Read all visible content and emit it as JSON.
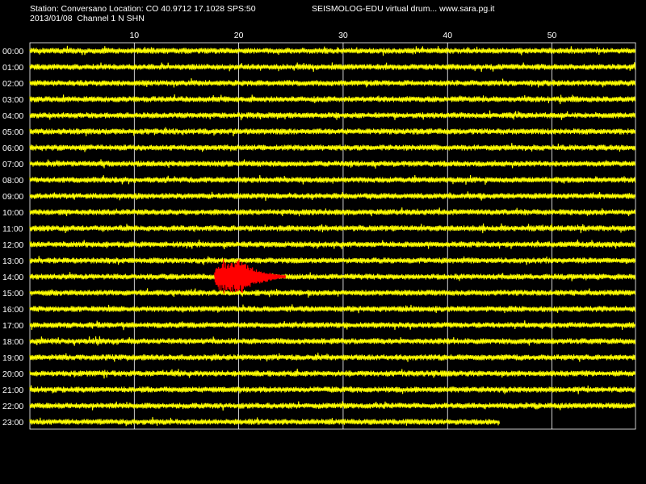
{
  "header": {
    "station_line": "Station: Conversano Location: CO 40.9712 17.1028 SPS:50",
    "title": "SEISMOLOG-EDU virtual drum... www.sara.pg.it",
    "date_line": "2013/01/08  Channel 1 N SHN"
  },
  "chart_data": {
    "type": "line",
    "title": "",
    "xlabel": "",
    "ylabel": "",
    "x_unit": "minutes",
    "xlim": [
      0,
      58
    ],
    "x_ticks": [
      10,
      20,
      30,
      40,
      50
    ],
    "grid": true,
    "hours": [
      "00:00",
      "01:00",
      "02:00",
      "03:00",
      "04:00",
      "05:00",
      "06:00",
      "07:00",
      "08:00",
      "09:00",
      "10:00",
      "11:00",
      "12:00",
      "13:00",
      "14:00",
      "15:00",
      "16:00",
      "17:00",
      "18:00",
      "19:00",
      "20:00",
      "21:00",
      "22:00",
      "23:00"
    ],
    "last_row_end_minute": 45,
    "trace_color": "#ffff00",
    "event_color": "#ff0000",
    "event": {
      "row": "14:00",
      "start_minute": 17.7,
      "end_minute": 24.5,
      "peak_minute": 20
    },
    "background_color": "#000000",
    "grid_color": "#ffffff"
  }
}
